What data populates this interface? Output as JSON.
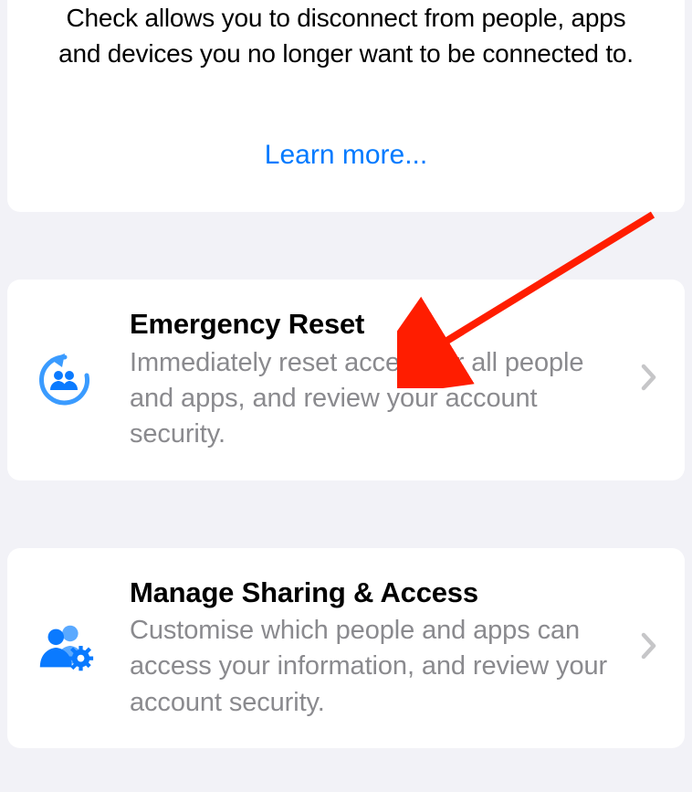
{
  "intro": {
    "text": "Check allows you to disconnect from people, apps and devices you no longer want to be connected to.",
    "learn_more": "Learn more..."
  },
  "options": [
    {
      "title": "Emergency Reset",
      "desc": "Immediately reset access for all people and apps, and review your account security."
    },
    {
      "title": "Manage Sharing & Access",
      "desc": "Customise which people and apps can access your information, and review your account security."
    }
  ]
}
